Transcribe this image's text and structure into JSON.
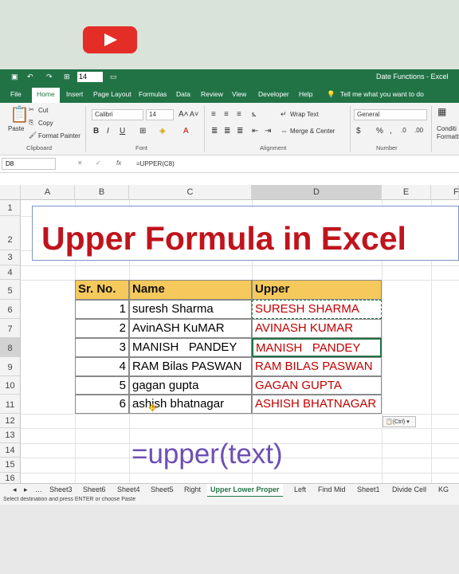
{
  "qat": {
    "font_size": "14",
    "title": "Date Functions  -  Excel"
  },
  "menu": [
    "File",
    "Home",
    "Insert",
    "Page Layout",
    "Formulas",
    "Data",
    "Review",
    "View",
    "Developer",
    "Help"
  ],
  "tell_me": "Tell me what you want to do",
  "ribbon": {
    "paste": "Paste",
    "cut": "Cut",
    "copy": "Copy",
    "format_painter": "Format Painter",
    "clipboard_group": "Clipboard",
    "font_name": "Calibri",
    "font_size": "14",
    "font_group": "Font",
    "wrap_text": "Wrap Text",
    "merge_center": "Merge & Center",
    "alignment_group": "Alignment",
    "number_format": "General",
    "number_group": "Number",
    "conditional": "Conditi Formatt"
  },
  "formula_bar": {
    "name_box": "D8",
    "fx": "fx",
    "formula": "=UPPER(C8)"
  },
  "columns": [
    "A",
    "B",
    "C",
    "D",
    "E",
    "F"
  ],
  "rows": [
    "1",
    "2",
    "3",
    "4",
    "5",
    "6",
    "7",
    "8",
    "9",
    "10",
    "11",
    "12",
    "13",
    "14",
    "15",
    "16"
  ],
  "title": "Upper Formula in Excel",
  "table": {
    "headers": [
      "Sr. No.",
      "Name",
      "Upper"
    ],
    "rows": [
      [
        "1",
        "suresh Sharma",
        "SURESH SHARMA"
      ],
      [
        "2",
        "AvinASH KuMAR",
        "AVINASH KUMAR"
      ],
      [
        "3",
        "MANISH   PANDEY",
        "MANISH   PANDEY"
      ],
      [
        "4",
        "RAM Bilas PASWAN",
        "RAM BILAS PASWAN"
      ],
      [
        "5",
        "gagan gupta",
        "GAGAN GUPTA"
      ],
      [
        "6",
        "ashish bhatnagar",
        "ASHISH BHATNAGAR"
      ]
    ]
  },
  "paste_options": "(Ctrl)",
  "formula_display": "=upper(text)",
  "sheet_tabs": [
    "Sheet3",
    "Sheet6",
    "Sheet4",
    "Sheet5",
    "Right",
    "Upper Lower Proper",
    "Left",
    "Find Mid",
    "Sheet1",
    "Divide Cell",
    "KG"
  ],
  "active_tab": "Upper Lower Proper",
  "status_text": "Select destination and press ENTER or choose Paste",
  "colors": {
    "excel_green": "#217346",
    "title_red": "#c0141c",
    "header_fill": "#f5c95b",
    "upper_red": "#c00000",
    "formula_purple": "#6d4fb4"
  }
}
